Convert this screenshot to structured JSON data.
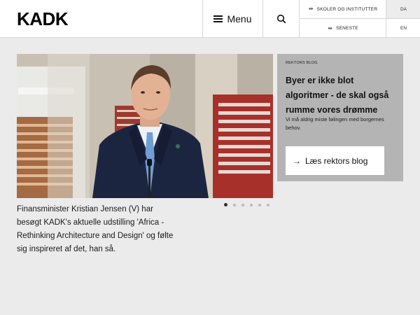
{
  "header": {
    "logo": "KADK",
    "menu_label": "Menu",
    "links": [
      {
        "label": "SKOLER OG INSTITUTTER",
        "icon": "arrows-icon"
      },
      {
        "label": "SENESTE",
        "icon": "arrows-icon"
      }
    ],
    "languages": [
      "DA",
      "EN"
    ],
    "active_language": "DA"
  },
  "slider": {
    "caption": "Finansminister Kristian Jensen (V) har besøgt KADK's aktuelle udstilling 'Africa - Rethinking Architecture and Design' og følte sig inspireret af det, han så.",
    "slide_count": 6,
    "active_slide": 1
  },
  "blog": {
    "tag": "REKTORS BLOG",
    "title": "Byer er ikke blot algoritmer - de skal også rumme vores drømme",
    "subtitle": "Vi må aldrig miste følingen med borgernes behov.",
    "button_label": "Læs rektors blog"
  },
  "colors": {
    "background": "#ebebeb",
    "header": "#ffffff",
    "blog_box": "#b4b4b4",
    "button": "#ffffff"
  }
}
